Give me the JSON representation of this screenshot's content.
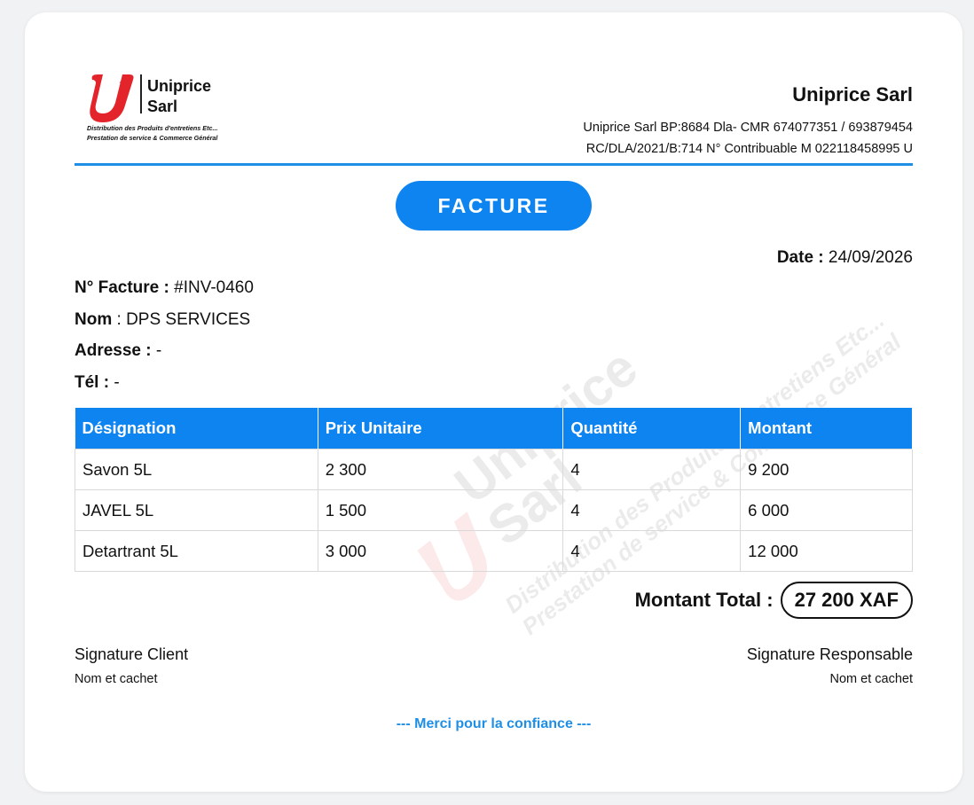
{
  "logo": {
    "brand_line1": "Uniprice",
    "brand_line2": "Sarl",
    "tagline1": "Distribution des Produits d'entretiens Etc...",
    "tagline2": "Prestation de service & Commerce Général"
  },
  "company": {
    "name": "Uniprice Sarl",
    "line1": "Uniprice Sarl BP:8684 Dla- CMR 674077351 / 693879454",
    "line2": "RC/DLA/2021/B:714 N° Contribuable M 022118458995 U"
  },
  "document_title": "FACTURE",
  "date": {
    "label": "Date :",
    "value": "24/09/2026"
  },
  "customer": {
    "invoice_label": "N° Facture :",
    "invoice_value": "#INV-0460",
    "name_label": "Nom",
    "name_value": ": DPS SERVICES",
    "address_label": "Adresse :",
    "address_value": "-",
    "phone_label": "Tél :",
    "phone_value": "-"
  },
  "table": {
    "headers": [
      "Désignation",
      "Prix Unitaire",
      "Quantité",
      "Montant"
    ],
    "rows": [
      [
        "Savon 5L",
        "2 300",
        "4",
        "9 200"
      ],
      [
        "JAVEL 5L",
        "1 500",
        "4",
        "6 000"
      ],
      [
        "Detartrant 5L",
        "3 000",
        "4",
        "12 000"
      ]
    ]
  },
  "total": {
    "label": "Montant Total :",
    "value": "27 200 XAF"
  },
  "signatures": {
    "client_title": "Signature Client",
    "client_sub": "Nom et cachet",
    "manager_title": "Signature Responsable",
    "manager_sub": "Nom et cachet"
  },
  "footer": "--- Merci pour la confiance ---",
  "colors": {
    "accent": "#0d84f0",
    "rule": "#1f8fe5",
    "logo_red": "#e3242b"
  }
}
